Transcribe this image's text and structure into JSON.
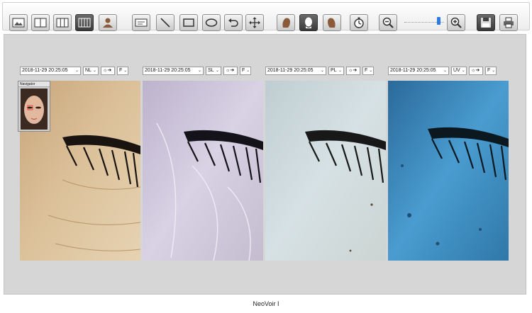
{
  "toolbar": {
    "groups": [
      [
        "image-view-icon",
        "split-2-icon",
        "split-3-icon",
        "split-4-icon",
        "patient-icon"
      ],
      [
        "text-annotation-icon",
        "line-tool-icon",
        "rectangle-tool-icon",
        "ellipse-tool-icon",
        "undo-icon",
        "move-icon"
      ],
      [
        "face-left-icon",
        "face-front-icon",
        "face-right-icon"
      ],
      [
        "timer-icon"
      ],
      [
        "zoom-out-icon",
        "zoom-in-icon"
      ],
      [
        "save-icon",
        "print-icon"
      ]
    ],
    "active": "split-4-icon",
    "selected_view": "face-front-icon",
    "zoom_level": 0.82,
    "accent_color": "#2a7be4"
  },
  "navigator": {
    "title": "Navigator"
  },
  "panels": [
    {
      "date": "2018-11-29 20:25:05",
      "mode": "NL",
      "light_label": "☼➔",
      "filter": "F",
      "tint": "#d9c09a"
    },
    {
      "date": "2018-11-29 20:25:05",
      "mode": "SL",
      "light_label": "☼➔",
      "filter": "F",
      "tint": "#cfc9dc"
    },
    {
      "date": "2018-11-29 20:25:05",
      "mode": "PL",
      "light_label": "☼➔",
      "filter": "F",
      "tint": "#c9d6da"
    },
    {
      "date": "2018-11-29 20:25:05",
      "mode": "UV",
      "light_label": "☼➔",
      "filter": "F",
      "tint": "#3f8fc0"
    }
  ],
  "status": {
    "text": "NeoVoir I"
  }
}
